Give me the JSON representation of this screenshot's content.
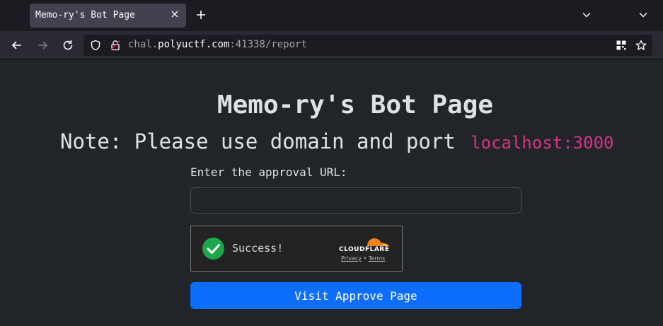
{
  "browser": {
    "tab_title": "Memo-ry's Bot Page",
    "url_prefix": "chal.",
    "url_host": "polyuctf.com",
    "url_suffix": ":41338/report"
  },
  "page": {
    "title": "Memo-ry's Bot Page",
    "note_text": "Note: Please use domain and port",
    "note_code": "localhost:3000",
    "input_label": "Enter the approval URL:",
    "input_value": "",
    "captcha_status": "Success!",
    "captcha_brand": "CLOUDFLARE",
    "captcha_privacy": "Privacy",
    "captcha_separator": "•",
    "captcha_terms": "Terms",
    "submit_label": "Visit Approve Page"
  },
  "colors": {
    "page_bg": "#212529",
    "primary": "#0d6efd",
    "code": "#d63384",
    "success": "#1ca74b",
    "cloudflare": "#f48120"
  }
}
